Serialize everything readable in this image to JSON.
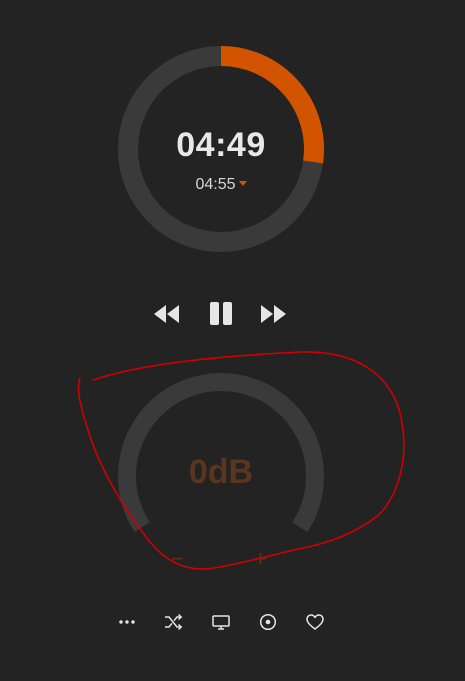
{
  "timer": {
    "elapsed": "04:49",
    "total": "04:55",
    "progress": 0.25,
    "accent_color": "#d35400",
    "track_color": "#3a3a3a"
  },
  "transport": {
    "rewind_icon": "rewind-icon",
    "pause_icon": "pause-icon",
    "forward_icon": "fast-forward-icon"
  },
  "volume": {
    "label": "0dB",
    "minus": "−",
    "plus": "+",
    "label_color": "#5a3620",
    "track_color": "#3a3a3a"
  },
  "toolbar": {
    "icons": [
      "more-icon",
      "shuffle-icon",
      "display-icon",
      "target-icon",
      "heart-icon"
    ]
  }
}
